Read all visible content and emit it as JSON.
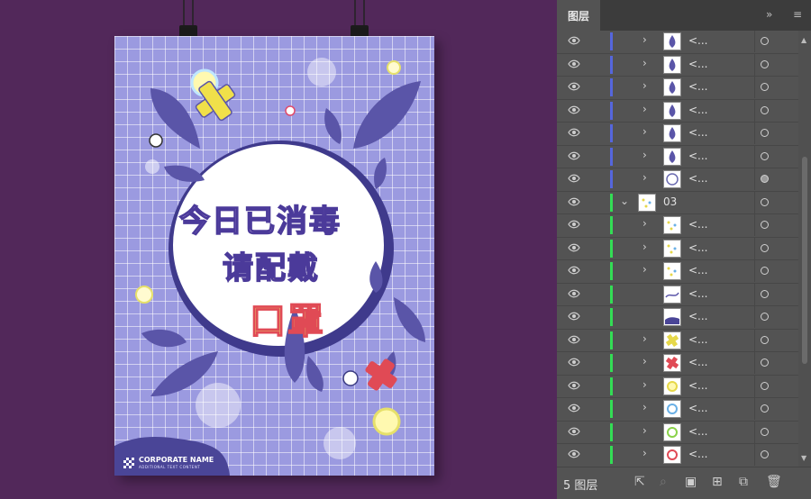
{
  "panel": {
    "tab_label": "图层",
    "collapse_icon": "double-chevron-right-icon",
    "menu_icon": "hamburger-menu-icon",
    "footer_count": "5 图层",
    "footer_icons": [
      "export-icon",
      "search-icon",
      "clip-mask-icon",
      "new-sublayer-icon",
      "new-layer-icon",
      "trash-icon"
    ],
    "layers": [
      {
        "name": "<...",
        "indent": 1,
        "color": "#5566dd",
        "expandable": true,
        "thumb": "drop",
        "target": "empty"
      },
      {
        "name": "<...",
        "indent": 1,
        "color": "#5566dd",
        "expandable": true,
        "thumb": "drop",
        "target": "empty"
      },
      {
        "name": "<...",
        "indent": 1,
        "color": "#5566dd",
        "expandable": true,
        "thumb": "drop",
        "target": "empty"
      },
      {
        "name": "<...",
        "indent": 1,
        "color": "#5566dd",
        "expandable": true,
        "thumb": "drop",
        "target": "empty"
      },
      {
        "name": "<...",
        "indent": 1,
        "color": "#5566dd",
        "expandable": true,
        "thumb": "drop",
        "target": "empty"
      },
      {
        "name": "<...",
        "indent": 1,
        "color": "#5566dd",
        "expandable": true,
        "thumb": "drop",
        "target": "empty"
      },
      {
        "name": "<...",
        "indent": 1,
        "color": "#5566dd",
        "expandable": true,
        "thumb": "circle",
        "target": "filled"
      },
      {
        "name": "03",
        "indent": 0,
        "color": "#33dd55",
        "expandable": true,
        "expanded": true,
        "thumb": "dots",
        "target": "empty"
      },
      {
        "name": "<...",
        "indent": 1,
        "color": "#33dd55",
        "expandable": true,
        "thumb": "dots",
        "target": "empty"
      },
      {
        "name": "<...",
        "indent": 1,
        "color": "#33dd55",
        "expandable": true,
        "thumb": "dots",
        "target": "empty"
      },
      {
        "name": "<...",
        "indent": 1,
        "color": "#33dd55",
        "expandable": true,
        "thumb": "dots",
        "target": "empty"
      },
      {
        "name": "<...",
        "indent": 1,
        "color": "#33dd55",
        "expandable": false,
        "thumb": "line",
        "target": "empty"
      },
      {
        "name": "<...",
        "indent": 1,
        "color": "#33dd55",
        "expandable": false,
        "thumb": "blob",
        "target": "empty"
      },
      {
        "name": "<...",
        "indent": 1,
        "color": "#33dd55",
        "expandable": true,
        "thumb": "cross-yellow",
        "target": "empty"
      },
      {
        "name": "<...",
        "indent": 1,
        "color": "#33dd55",
        "expandable": true,
        "thumb": "cross-red",
        "target": "empty"
      },
      {
        "name": "<...",
        "indent": 1,
        "color": "#33dd55",
        "expandable": true,
        "thumb": "virus-yellow",
        "target": "empty"
      },
      {
        "name": "<...",
        "indent": 1,
        "color": "#33dd55",
        "expandable": true,
        "thumb": "virus-blue",
        "target": "empty"
      },
      {
        "name": "<...",
        "indent": 1,
        "color": "#33dd55",
        "expandable": true,
        "thumb": "virus-green",
        "target": "empty"
      },
      {
        "name": "<...",
        "indent": 1,
        "color": "#33dd55",
        "expandable": true,
        "thumb": "virus-red",
        "target": "empty"
      }
    ]
  },
  "poster": {
    "title_line1": "今日已消毒",
    "title_line2": "请配戴",
    "title_line3": "口罩",
    "company": "CORPORATE NAME",
    "tagline": "ADDITIONAL TEXT CONTENT"
  },
  "colors": {
    "canvas_bg": "#52285a",
    "poster_bg": "#9b9ae0",
    "drop": "#5a55a8",
    "panel_bg": "#535353"
  }
}
